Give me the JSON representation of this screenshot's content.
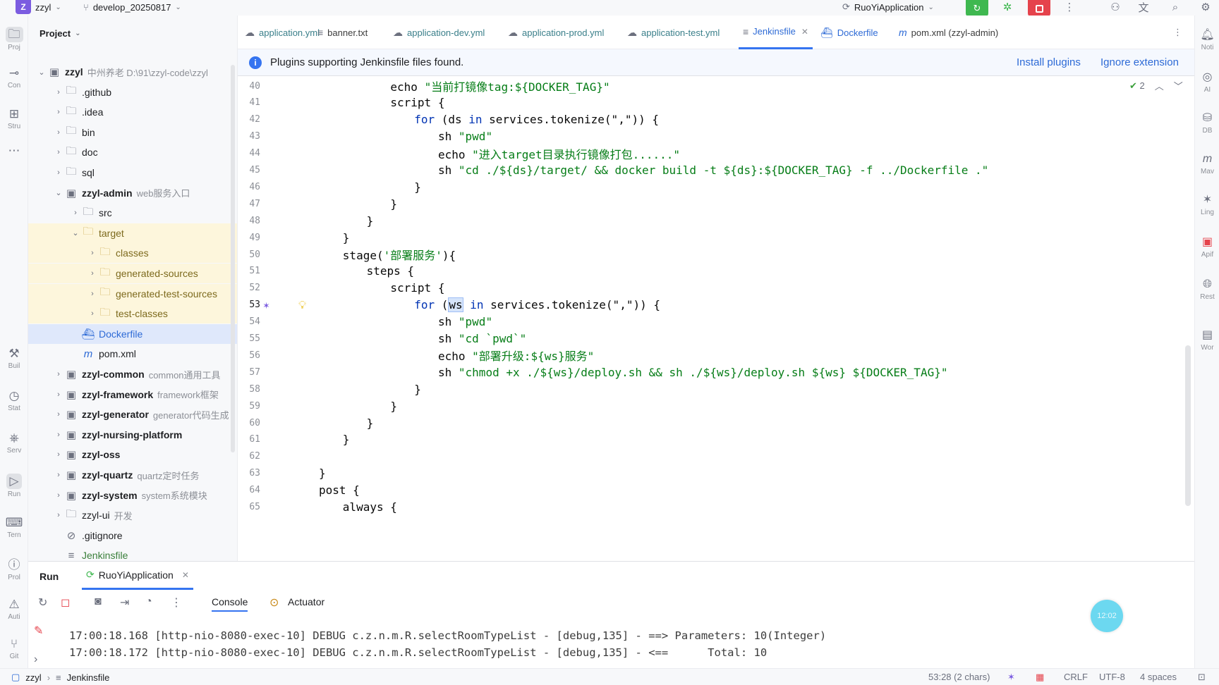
{
  "titlebar": {
    "project_badge": "Z",
    "project_name": "zzyl",
    "branch": "develop_20250817",
    "run_config": "RuoYiApplication"
  },
  "left_stripe": [
    {
      "icon": "folder-icon",
      "label": "Proj"
    },
    {
      "icon": "commit-icon",
      "label": "Con"
    },
    {
      "icon": "structure-icon",
      "label": "Stru"
    },
    {
      "icon": "more-icon",
      "label": "..."
    },
    {
      "icon": "build-icon",
      "label": "Buil"
    },
    {
      "icon": "services-icon",
      "label": "Stat"
    },
    {
      "icon": "services-icon",
      "label": "Serv"
    },
    {
      "icon": "run-icon",
      "label": "Run"
    },
    {
      "icon": "terminal-icon",
      "label": "Tern"
    },
    {
      "icon": "problems-icon",
      "label": "Prol"
    },
    {
      "icon": "warning-icon",
      "label": "Auti"
    },
    {
      "icon": "git-icon",
      "label": "Git"
    }
  ],
  "right_stripe": [
    {
      "icon": "notifications-icon",
      "label": "Noti"
    },
    {
      "icon": "ai-icon",
      "label": "AI"
    },
    {
      "icon": "database-icon",
      "label": "DB"
    },
    {
      "icon": "maven-icon",
      "label": "Mav"
    },
    {
      "icon": "lingma-icon",
      "label": "Ling"
    },
    {
      "icon": "apifox-icon",
      "label": "Apif"
    },
    {
      "icon": "rest-icon",
      "label": "Rest"
    },
    {
      "icon": "word-icon",
      "label": "Wor"
    }
  ],
  "project_panel": {
    "title": "Project",
    "tree": [
      {
        "name": "zzyl",
        "hint": "中州养老  D:\\91\\zzyl-code\\zzyl",
        "level": 0,
        "expanded": true,
        "bold": true
      },
      {
        "name": ".github",
        "level": 1
      },
      {
        "name": ".idea",
        "level": 1
      },
      {
        "name": "bin",
        "level": 1
      },
      {
        "name": "doc",
        "level": 1
      },
      {
        "name": "sql",
        "level": 1
      },
      {
        "name": "zzyl-admin",
        "hint": "web服务入口",
        "level": 1,
        "expanded": true,
        "bold": true
      },
      {
        "name": "src",
        "level": 2
      },
      {
        "name": "target",
        "level": 2,
        "expanded": true,
        "excluded": true
      },
      {
        "name": "classes",
        "level": 3,
        "excluded": true
      },
      {
        "name": "generated-sources",
        "level": 3,
        "excluded": true
      },
      {
        "name": "generated-test-sources",
        "level": 3,
        "excluded": true
      },
      {
        "name": "test-classes",
        "level": 3,
        "excluded": true
      },
      {
        "name": "Dockerfile",
        "level": 2,
        "file": true,
        "selected": true
      },
      {
        "name": "pom.xml",
        "level": 2,
        "file": true
      },
      {
        "name": "zzyl-common",
        "hint": "common通用工具",
        "level": 1,
        "bold": true
      },
      {
        "name": "zzyl-framework",
        "hint": "framework框架",
        "level": 1,
        "bold": true
      },
      {
        "name": "zzyl-generator",
        "hint": "generator代码生成",
        "level": 1,
        "bold": true
      },
      {
        "name": "zzyl-nursing-platform",
        "level": 1,
        "bold": true
      },
      {
        "name": "zzyl-oss",
        "level": 1,
        "bold": true
      },
      {
        "name": "zzyl-quartz",
        "hint": "quartz定时任务",
        "level": 1,
        "bold": true
      },
      {
        "name": "zzyl-system",
        "hint": "system系统模块",
        "level": 1,
        "bold": true
      },
      {
        "name": "zzyl-ui",
        "hint": "开发",
        "level": 1
      },
      {
        "name": ".gitignore",
        "level": 1,
        "file": true
      },
      {
        "name": "Jenkinsfile",
        "level": 1,
        "file": true
      }
    ]
  },
  "tabs": [
    {
      "label": "application.yml",
      "icon": "yaml-icon"
    },
    {
      "label": "banner.txt",
      "icon": "text-icon"
    },
    {
      "label": "application-dev.yml",
      "icon": "yaml-icon"
    },
    {
      "label": "application-prod.yml",
      "icon": "yaml-icon"
    },
    {
      "label": "application-test.yml",
      "icon": "yaml-icon"
    },
    {
      "label": "Jenkinsfile",
      "icon": "text-icon",
      "active": true
    },
    {
      "label": "Dockerfile",
      "icon": "docker-icon"
    },
    {
      "label": "pom.xml (zzyl-admin)",
      "icon": "maven-icon"
    }
  ],
  "banner": {
    "message": "Plugins supporting Jenkinsfile files found.",
    "install": "Install plugins",
    "ignore": "Ignore extension"
  },
  "editor_status": {
    "checks": "2"
  },
  "editor": {
    "lines": [
      {
        "n": "40",
        "indent": 12,
        "parts": [
          [
            "echo ",
            ""
          ],
          [
            "\"当前打镜像tag:${DOCKER_TAG}\"",
            "str"
          ]
        ]
      },
      {
        "n": "41",
        "indent": 12,
        "parts": [
          [
            "script {",
            ""
          ]
        ]
      },
      {
        "n": "42",
        "indent": 16,
        "parts": [
          [
            "for",
            "kw"
          ],
          [
            " (ds ",
            ""
          ],
          [
            "in",
            "kw"
          ],
          [
            " services.tokenize(\",\")) {",
            ""
          ]
        ]
      },
      {
        "n": "43",
        "indent": 20,
        "parts": [
          [
            "sh ",
            ""
          ],
          [
            "\"pwd\"",
            "str"
          ]
        ]
      },
      {
        "n": "44",
        "indent": 20,
        "parts": [
          [
            "echo ",
            ""
          ],
          [
            "\"进入target目录执行镜像打包......\"",
            "str"
          ]
        ]
      },
      {
        "n": "45",
        "indent": 20,
        "parts": [
          [
            "sh ",
            ""
          ],
          [
            "\"cd ./${ds}/target/ && docker build -t ${ds}:${DOCKER_TAG} -f ../Dockerfile .\"",
            "str"
          ]
        ]
      },
      {
        "n": "46",
        "indent": 16,
        "parts": [
          [
            "}",
            ""
          ]
        ]
      },
      {
        "n": "47",
        "indent": 12,
        "parts": [
          [
            "}",
            ""
          ]
        ]
      },
      {
        "n": "48",
        "indent": 8,
        "parts": [
          [
            "}",
            ""
          ]
        ]
      },
      {
        "n": "49",
        "indent": 4,
        "parts": [
          [
            "}",
            ""
          ]
        ]
      },
      {
        "n": "50",
        "indent": 4,
        "parts": [
          [
            "stage(",
            ""
          ],
          [
            "'部署服务'",
            "str"
          ],
          [
            "){",
            ""
          ]
        ]
      },
      {
        "n": "51",
        "indent": 8,
        "parts": [
          [
            "steps {",
            ""
          ]
        ]
      },
      {
        "n": "52",
        "indent": 12,
        "parts": [
          [
            "script {",
            ""
          ]
        ]
      },
      {
        "n": "53",
        "indent": 16,
        "parts": [
          [
            "for",
            "kw"
          ],
          [
            " (",
            ""
          ],
          [
            "ws",
            "sel"
          ],
          [
            " ",
            ""
          ],
          [
            "in",
            "kw"
          ],
          [
            " services.tokenize(\",\")) {",
            ""
          ]
        ],
        "current": true
      },
      {
        "n": "54",
        "indent": 20,
        "parts": [
          [
            "sh ",
            ""
          ],
          [
            "\"pwd\"",
            "str"
          ]
        ]
      },
      {
        "n": "55",
        "indent": 20,
        "parts": [
          [
            "sh ",
            ""
          ],
          [
            "\"cd `pwd`\"",
            "str"
          ]
        ]
      },
      {
        "n": "56",
        "indent": 20,
        "parts": [
          [
            "echo ",
            ""
          ],
          [
            "\"部署升级:${ws}服务\"",
            "str"
          ]
        ]
      },
      {
        "n": "57",
        "indent": 20,
        "parts": [
          [
            "sh ",
            ""
          ],
          [
            "\"chmod +x ./${ws}/deploy.sh && sh ./${ws}/deploy.sh ${ws} ${DOCKER_TAG}\"",
            "str"
          ]
        ]
      },
      {
        "n": "58",
        "indent": 16,
        "parts": [
          [
            "}",
            ""
          ]
        ]
      },
      {
        "n": "59",
        "indent": 12,
        "parts": [
          [
            "}",
            ""
          ]
        ]
      },
      {
        "n": "60",
        "indent": 8,
        "parts": [
          [
            "}",
            ""
          ]
        ]
      },
      {
        "n": "61",
        "indent": 4,
        "parts": [
          [
            "}",
            ""
          ]
        ]
      },
      {
        "n": "62",
        "indent": 0,
        "parts": []
      },
      {
        "n": "63",
        "indent": 0,
        "parts": [
          [
            "}",
            ""
          ]
        ]
      },
      {
        "n": "64",
        "indent": 0,
        "parts": [
          [
            "post {",
            ""
          ]
        ]
      },
      {
        "n": "65",
        "indent": 4,
        "parts": [
          [
            "always {",
            ""
          ]
        ]
      }
    ]
  },
  "run_panel": {
    "title": "Run",
    "tab_label": "RuoYiApplication",
    "console_label": "Console",
    "actuator_label": "Actuator",
    "logs": [
      "17:00:18.168 [http-nio-8080-exec-10] DEBUG c.z.n.m.R.selectRoomTypeList - [debug,135] - ==> Parameters: 10(Integer)",
      "17:00:18.172 [http-nio-8080-exec-10] DEBUG c.z.n.m.R.selectRoomTypeList - [debug,135] - <==      Total: 10"
    ],
    "timer": "12:02"
  },
  "statusbar": {
    "project": "zzyl",
    "file": "Jenkinsfile",
    "position": "53:28 (2 chars)",
    "line_sep": "CRLF",
    "encoding": "UTF-8",
    "indent": "4 spaces"
  },
  "colors": {
    "accent": "#3574f0",
    "keyword": "#0033b3",
    "string": "#067d17",
    "run_green": "#3fb850",
    "stop_red": "#e5434c",
    "project_badge": "#7b5ce0"
  }
}
